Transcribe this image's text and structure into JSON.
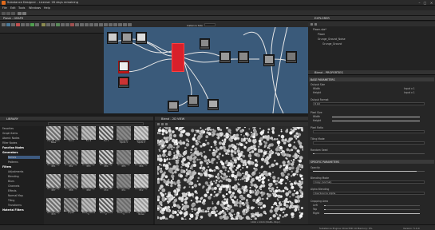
{
  "titlebar": {
    "title": "Substance Designer - License: 26 days remaining"
  },
  "menubar": {
    "items": [
      "File",
      "Edit",
      "Tools",
      "Windows",
      "Help"
    ]
  },
  "graph": {
    "panel_title": "Plasm - GRAPH",
    "explorer_label": "Instance Size"
  },
  "explorer": {
    "title": "EXPLORER",
    "items": [
      "Plasm.sbs*",
      "Plasm",
      "Grunge_Ground_Noise",
      "Grunge_Ground"
    ]
  },
  "properties": {
    "title": "Blend - PROPERTIES",
    "sections": {
      "base": "BASE PARAMETERS",
      "specific": "SPECIFIC PARAMETERS"
    },
    "base_rows": [
      {
        "label": "Output Size",
        "value": ""
      },
      {
        "label": "Width",
        "value": "Input x 1"
      },
      {
        "label": "Height",
        "value": "Input x 1"
      },
      {
        "label": "Output Format",
        "value": "8 bit"
      },
      {
        "label": "Pixel Size",
        "value": ""
      },
      {
        "label": "Width",
        "value": ""
      },
      {
        "label": "Height",
        "value": ""
      },
      {
        "label": "Pixel Ratio",
        "value": ""
      },
      {
        "label": "Tiling Mode",
        "value": ""
      },
      {
        "label": "Random Seed",
        "value": ""
      }
    ],
    "specific_rows": [
      {
        "label": "Opacity",
        "value": ""
      },
      {
        "label": "Blending Mode",
        "value": "Copy (normal)"
      },
      {
        "label": "Alpha Blending",
        "value": "Use Source Alpha"
      },
      {
        "label": "Cropping Area",
        "value": ""
      },
      {
        "label": "Left",
        "value": ""
      },
      {
        "label": "Top",
        "value": ""
      },
      {
        "label": "Right",
        "value": ""
      }
    ]
  },
  "library": {
    "title": "LIBRARY",
    "search_placeholder": "Search",
    "tree": [
      "Favorites",
      "Graph Items",
      "Atomic Nodes",
      "Filter Nodes",
      "Function Nodes",
      "Generators",
      "Noises",
      "Patterns",
      "Filters",
      "Adjustments",
      "Blending",
      "Blurs",
      "Channels",
      "Effects",
      "Normal Map",
      "Tiling",
      "Transforms",
      "Material Filters"
    ],
    "thumbs": [
      "Fractal Sum Base",
      "Fur 1",
      "Fur 2",
      "Fur 3",
      "Gaussian Spots 1",
      "Gaussian Spots 2",
      "Grunge Map 001",
      "Grunge Map 002",
      "Grunge Map 003",
      "Grunge Map 004",
      "Grunge Map 005",
      "Grunge Map 006",
      "Grunge Map 007",
      "Grunge Map 008",
      "Grunge Map 009",
      "Grunge Map 010",
      "Grunge Map 011",
      "Grunge Map 012",
      "Grunge Map 013",
      "Liquid",
      "Messy Fibers 1",
      "Messy Fibers 2",
      "Messy Fibers 3",
      "Moisture Noise"
    ]
  },
  "view2d": {
    "title": "Blend - 2D VIEW",
    "zoom": "1024 x 1024 (RGBA, 8bpc)"
  },
  "statusbar": {
    "text": "Substance Engine: Direct3D 10  Memory: 0%",
    "version": "Version: 5.0.0"
  },
  "colors": {
    "accent": "#e06a1c",
    "graph_bg": "#3a5a7a",
    "selected_node": "#d8202a"
  }
}
